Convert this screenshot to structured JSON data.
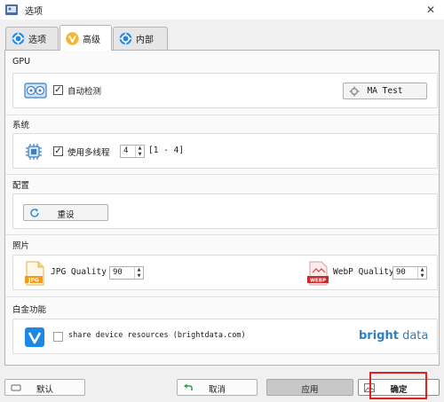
{
  "window": {
    "title": "选项",
    "close_symbol": "✕"
  },
  "tabs": [
    {
      "label": "选项",
      "icon": "gear-icon",
      "active": false
    },
    {
      "label": "高级",
      "icon": "v-shield-icon",
      "active": true
    },
    {
      "label": "内部",
      "icon": "gear-icon",
      "active": false
    }
  ],
  "gpu": {
    "title": "GPU",
    "icon": "gpu-card-icon",
    "auto_detect_label": "自动检测",
    "auto_detect_checked": true,
    "test_button_label": "MA Test",
    "test_button_icon": "gear-icon"
  },
  "system": {
    "title": "系统",
    "icon": "cpu-chip-icon",
    "multithread_label": "使用多线程",
    "multithread_checked": true,
    "threads_value": "4",
    "threads_range": "[1 - 4]"
  },
  "config": {
    "title": "配置",
    "reset_label": "重设",
    "reset_icon": "refresh-icon"
  },
  "photo": {
    "title": "照片",
    "jpg_icon": "jpg-file-icon",
    "jpg_quality_label": "JPG Quality",
    "jpg_quality_value": "90",
    "jpg_badge": "JPG",
    "webp_icon": "webp-file-icon",
    "webp_quality_label": "WebP Quality",
    "webp_quality_value": "90",
    "webp_badge": "WEBP"
  },
  "platinum": {
    "title": "白金功能",
    "icon": "v-shield-icon",
    "share_label": "share device resources (brightdata.com)",
    "share_checked": false,
    "brand_part1": "bright",
    "brand_part2": " data"
  },
  "footer": {
    "default_label": "默认",
    "default_icon": "button-icon",
    "cancel_label": "取消",
    "cancel_icon": "back-arrow-icon",
    "apply_label": "应用",
    "ok_label": "确定",
    "ok_icon": "image-icon"
  },
  "colors": {
    "accent_blue": "#1e88e5",
    "brand_blue": "#2d7fc1",
    "brand_orange": "#f29b1d",
    "highlight_red": "#e0201a"
  }
}
